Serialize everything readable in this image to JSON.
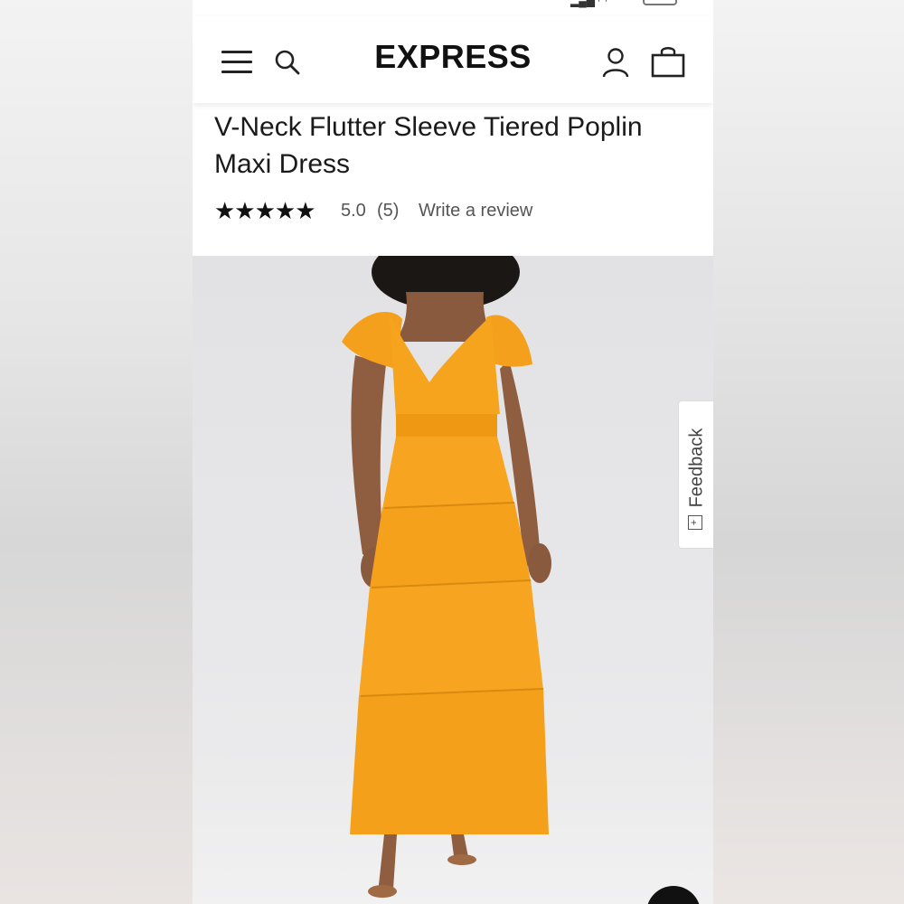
{
  "brand": {
    "logo_text": "EXPRESS"
  },
  "product": {
    "title": "V-Neck Flutter Sleeve Tiered Poplin Maxi Dress",
    "stars": "★★★★★",
    "rating": "5.0",
    "review_count": "(5)",
    "write_review_label": "Write a review",
    "image_alt": "Model wearing an orange tiered maxi dress"
  },
  "feedback": {
    "label": "Feedback",
    "icon_glyph": "+"
  },
  "icons": {
    "menu": "hamburger-menu-icon",
    "search": "search-icon",
    "account": "account-icon",
    "bag": "shopping-bag-icon",
    "chat": "chat-icon"
  },
  "colors": {
    "dress": "#f7a21b",
    "background_photo": "#e4e4e6",
    "text": "#1a1a1a",
    "muted_text": "#555555"
  }
}
